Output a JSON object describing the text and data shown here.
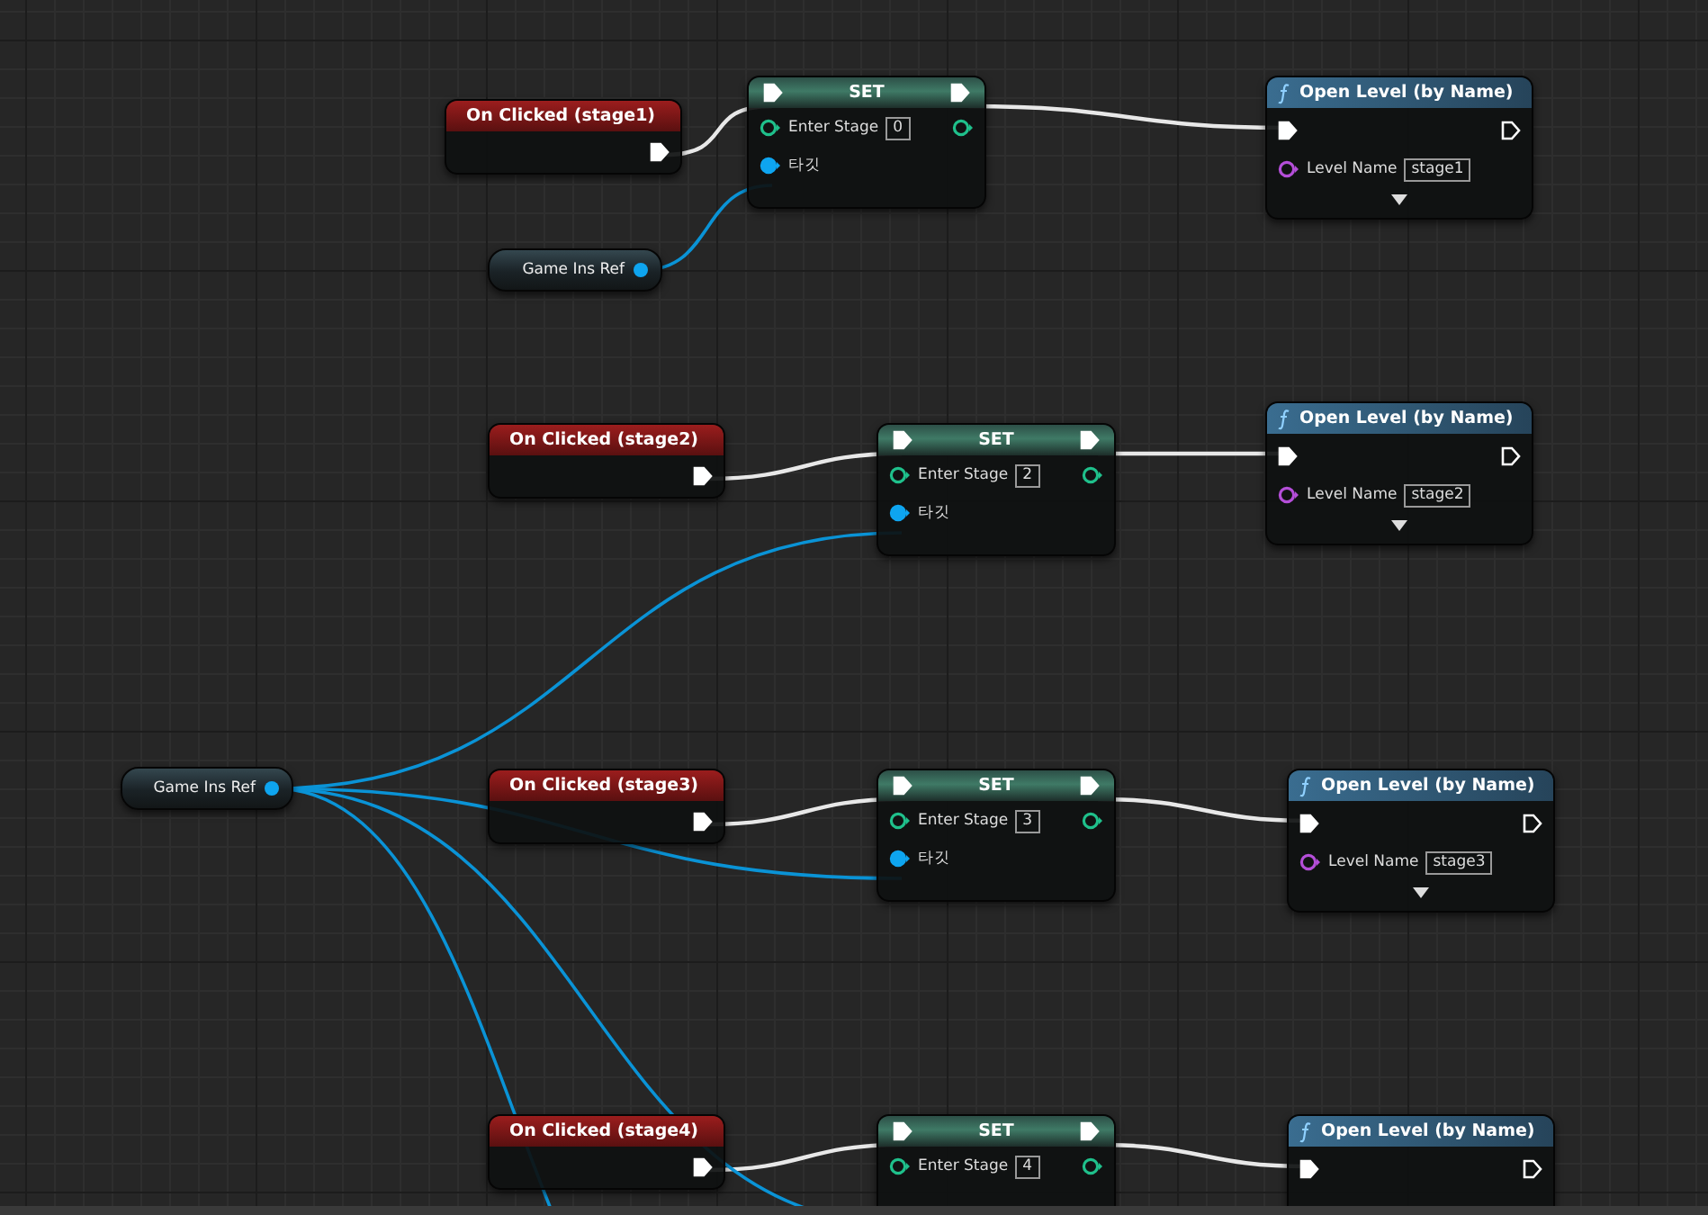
{
  "graph": {
    "rows": [
      {
        "event": "On Clicked (stage1)",
        "set": {
          "title": "SET",
          "variable": "Enter Stage",
          "value": "0",
          "target": "타깃"
        },
        "function": {
          "title": "Open Level (by Name)",
          "param": "Level Name",
          "value": "stage1"
        }
      },
      {
        "event": "On Clicked (stage2)",
        "set": {
          "title": "SET",
          "variable": "Enter Stage",
          "value": "2",
          "target": "타깃"
        },
        "function": {
          "title": "Open Level (by Name)",
          "param": "Level Name",
          "value": "stage2"
        }
      },
      {
        "event": "On Clicked (stage3)",
        "set": {
          "title": "SET",
          "variable": "Enter Stage",
          "value": "3",
          "target": "타깃"
        },
        "function": {
          "title": "Open Level (by Name)",
          "param": "Level Name",
          "value": "stage3"
        }
      },
      {
        "event": "On Clicked (stage4)",
        "set": {
          "title": "SET",
          "variable": "Enter Stage",
          "value": "4"
        },
        "function": {
          "title": "Open Level (by Name)"
        }
      }
    ],
    "references": [
      {
        "label": "Game Ins Ref"
      },
      {
        "label": "Game Ins Ref"
      }
    ]
  }
}
